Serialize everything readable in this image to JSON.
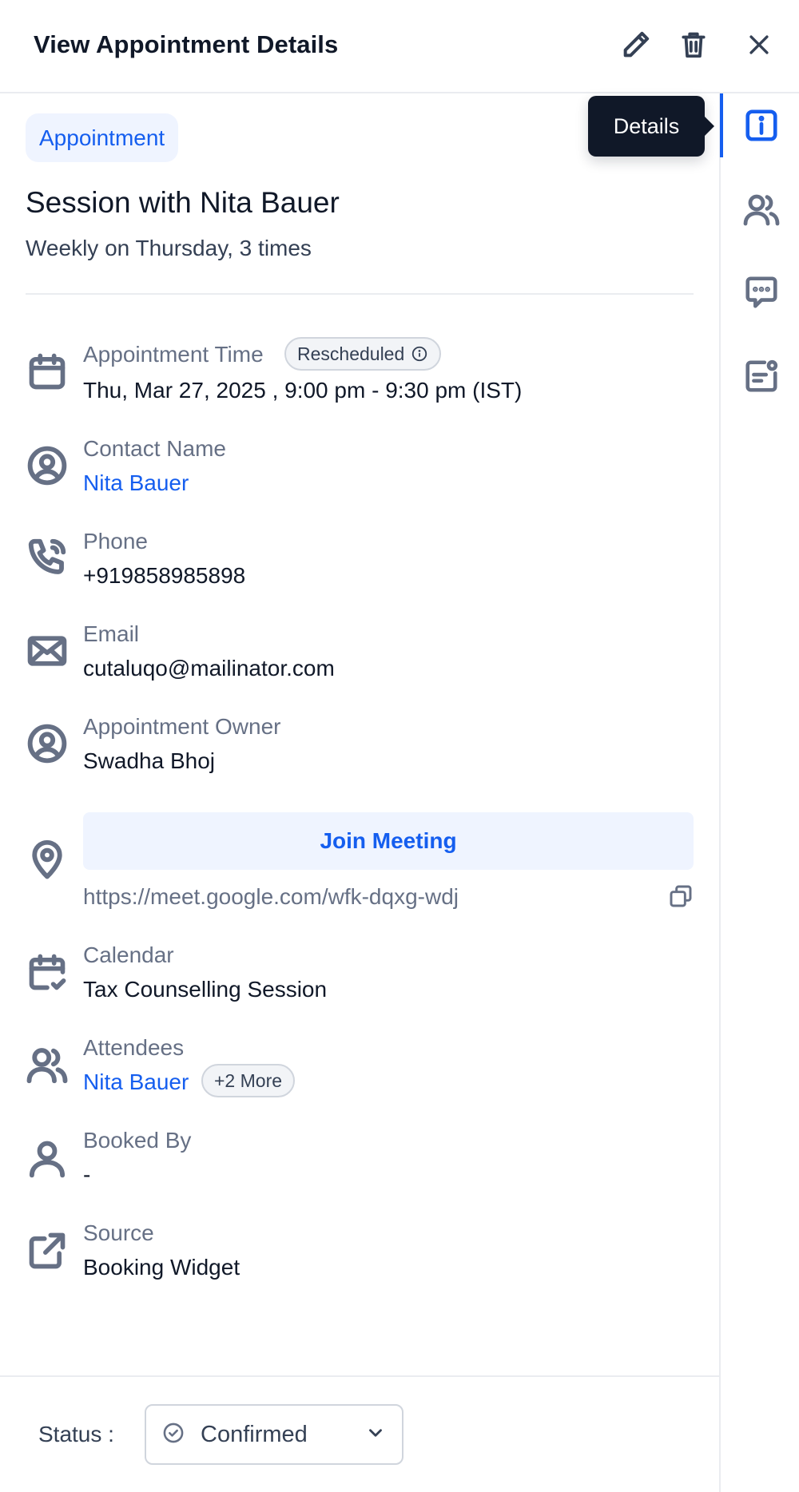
{
  "header": {
    "title": "View Appointment Details"
  },
  "tooltip": "Details",
  "appointment": {
    "type_badge": "Appointment",
    "title": "Session with Nita Bauer",
    "recurrence": "Weekly on Thursday, 3 times"
  },
  "fields": {
    "time_label": "Appointment Time",
    "time_badge": "Rescheduled",
    "time_value": "Thu, Mar 27, 2025 , 9:00 pm - 9:30 pm (IST)",
    "contact_label": "Contact Name",
    "contact_value": "Nita Bauer",
    "phone_label": "Phone",
    "phone_value": "+919858985898",
    "email_label": "Email",
    "email_value": "cutaluqo@mailinator.com",
    "owner_label": "Appointment Owner",
    "owner_value": "Swadha Bhoj",
    "join_button": "Join Meeting",
    "meeting_url": "https://meet.google.com/wfk-dqxg-wdj",
    "calendar_label": "Calendar",
    "calendar_value": "Tax Counselling Session",
    "attendees_label": "Attendees",
    "attendees_value": "Nita Bauer",
    "attendees_more": "+2 More",
    "booked_by_label": "Booked By",
    "booked_by_value": "-",
    "source_label": "Source",
    "source_value": "Booking Widget"
  },
  "footer": {
    "status_label": "Status :",
    "status_value": "Confirmed"
  },
  "icons": {
    "header": [
      "edit-icon",
      "trash-icon",
      "close-icon"
    ],
    "rail": [
      "info-icon",
      "users-icon",
      "message-icon",
      "notes-icon"
    ]
  },
  "colors": {
    "accent": "#155eef",
    "text_primary": "#101828",
    "text_muted": "#667085",
    "tooltip_bg": "#101828",
    "badge_bg": "#eff4ff"
  }
}
